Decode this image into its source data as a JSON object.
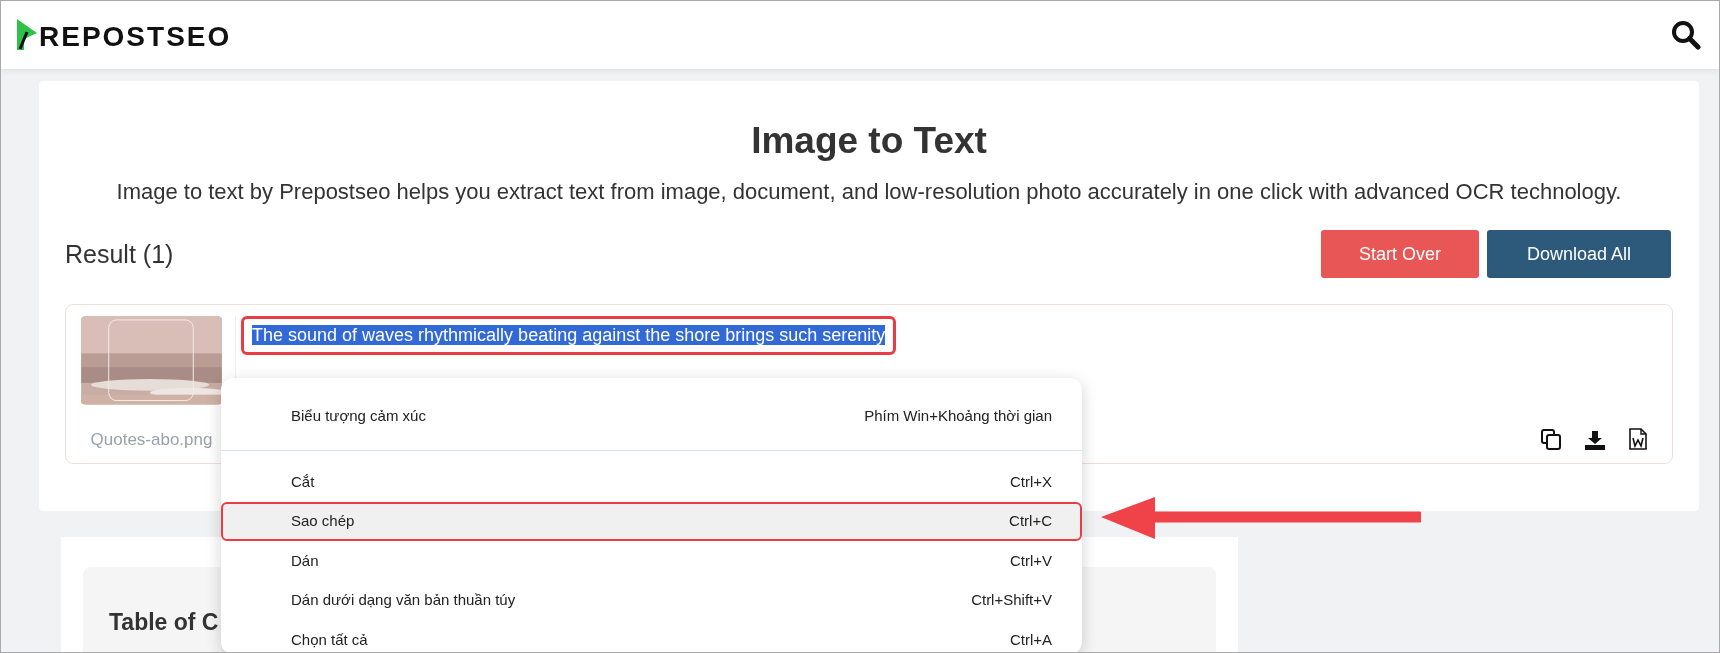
{
  "header": {
    "logo_text": "REPOSTSEO"
  },
  "tool": {
    "title": "Image to Text",
    "description": "Image to text by Prepostseo helps you extract text from image, document, and low-resolution photo accurately in one click with advanced OCR technology."
  },
  "result": {
    "heading": "Result (1)",
    "buttons": [
      {
        "label": "Start Over",
        "kind": "danger"
      },
      {
        "label": "Download All",
        "kind": "primary"
      }
    ],
    "items": [
      {
        "file_name": "Quotes-abo.png",
        "text": "The sound of waves rhythmically beating against the shore brings such serenity",
        "selected": true,
        "outlined": true
      }
    ]
  },
  "toc": {
    "title": "Table of C"
  },
  "context_menu": {
    "groups": [
      [
        {
          "label": "Biểu tượng cảm xúc",
          "shortcut": "Phím Win+Khoảng thời gian",
          "highlighted": false,
          "outlined": false
        }
      ],
      [
        {
          "label": "Cắt",
          "shortcut": "Ctrl+X",
          "highlighted": false,
          "outlined": false
        },
        {
          "label": "Sao chép",
          "shortcut": "Ctrl+C",
          "highlighted": true,
          "outlined": true
        },
        {
          "label": "Dán",
          "shortcut": "Ctrl+V",
          "highlighted": false,
          "outlined": false
        },
        {
          "label": "Dán dưới dạng văn bản thuần túy",
          "shortcut": "Ctrl+Shift+V",
          "highlighted": false,
          "outlined": false
        },
        {
          "label": "Chọn tất cả",
          "shortcut": "Ctrl+A",
          "highlighted": false,
          "outlined": false
        }
      ]
    ]
  }
}
